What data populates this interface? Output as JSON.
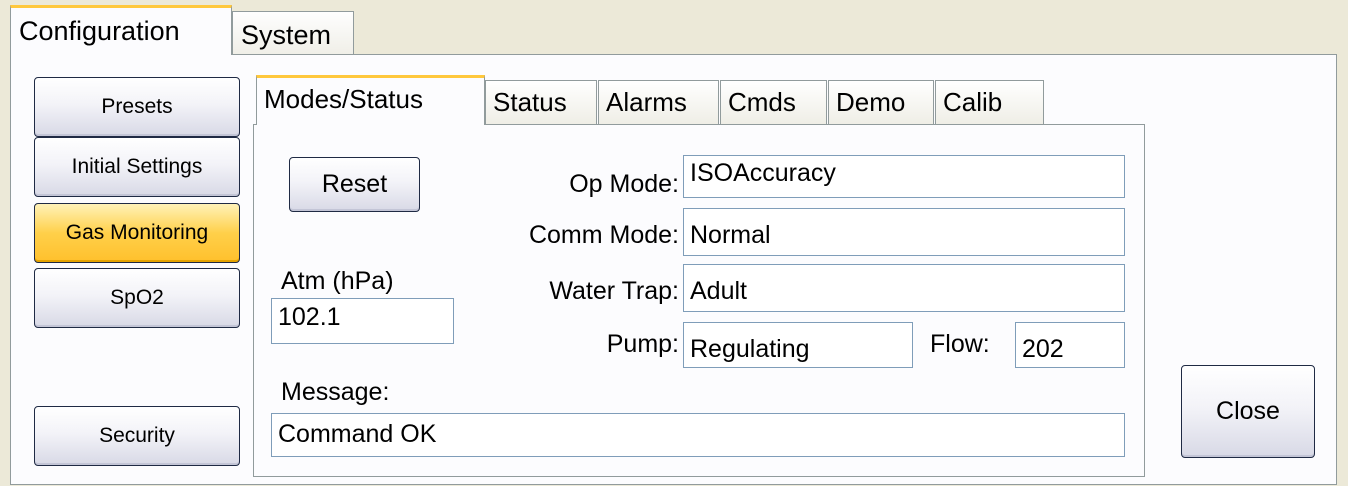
{
  "outer_tabs": {
    "configuration": "Configuration",
    "system": "System"
  },
  "sidebar": {
    "presets": "Presets",
    "initial_settings": "Initial Settings",
    "gas_monitoring": "Gas Monitoring",
    "spo2": "SpO2",
    "security": "Security"
  },
  "inner_tabs": {
    "modes_status": "Modes/Status",
    "status": "Status",
    "alarms": "Alarms",
    "cmds": "Cmds",
    "demo": "Demo",
    "calib": "Calib"
  },
  "panel": {
    "reset_label": "Reset",
    "op_mode_label": "Op Mode:",
    "op_mode_value": "ISOAccuracy",
    "comm_mode_label": "Comm Mode:",
    "comm_mode_value": "Normal",
    "atm_label": "Atm (hPa)",
    "atm_value": "102.1",
    "water_trap_label": "Water Trap:",
    "water_trap_value": "Adult",
    "pump_label": "Pump:",
    "pump_value": "Regulating",
    "flow_label": "Flow:",
    "flow_value": "202",
    "message_label": "Message:",
    "message_value": "Command OK"
  },
  "close_label": "Close"
}
